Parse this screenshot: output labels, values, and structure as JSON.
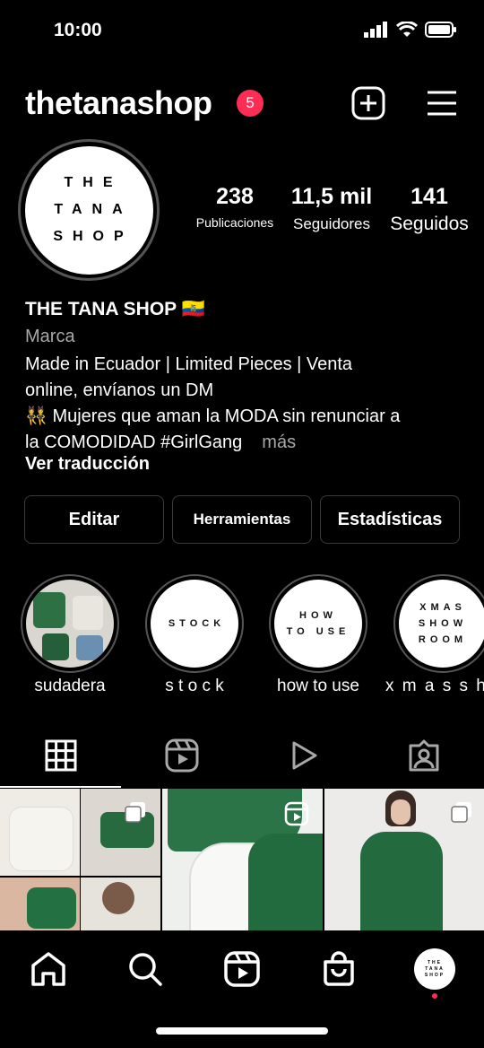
{
  "status": {
    "time": "10:00"
  },
  "header": {
    "username": "thetanashop",
    "notifications": "5"
  },
  "avatar": {
    "lines": [
      "THE",
      "TANA",
      "SHOP"
    ]
  },
  "stats": [
    {
      "value": "238",
      "label": "Publicaciones"
    },
    {
      "value": "11,5 mil",
      "label": "Seguidores"
    },
    {
      "value": "141",
      "label": "Seguidos"
    }
  ],
  "bio": {
    "name": "THE TANA SHOP 🇪🇨",
    "category": "Marca",
    "line1": "Made in Ecuador | Limited Pieces | Venta",
    "line2": "online, envíanos un DM",
    "line3": "👯 Mujeres que aman la MODA sin renunciar a",
    "line4": "la COMODIDAD #GirlGang",
    "more": "más",
    "translate": "Ver traducción"
  },
  "buttons": {
    "edit": "Editar",
    "tools": "Herramientas",
    "stats": "Estadísticas"
  },
  "highlights": [
    {
      "label": "sudadera",
      "cover": ""
    },
    {
      "label": "s t o c k",
      "cover": "STOCK"
    },
    {
      "label": "how to use",
      "cover": "HOW TO USE"
    },
    {
      "label": "x m a s  s h",
      "cover": "XMAS SHOW ROOM"
    }
  ],
  "colors": {
    "badge": "#ff2d55",
    "accent_green": "#1f6b3a"
  }
}
